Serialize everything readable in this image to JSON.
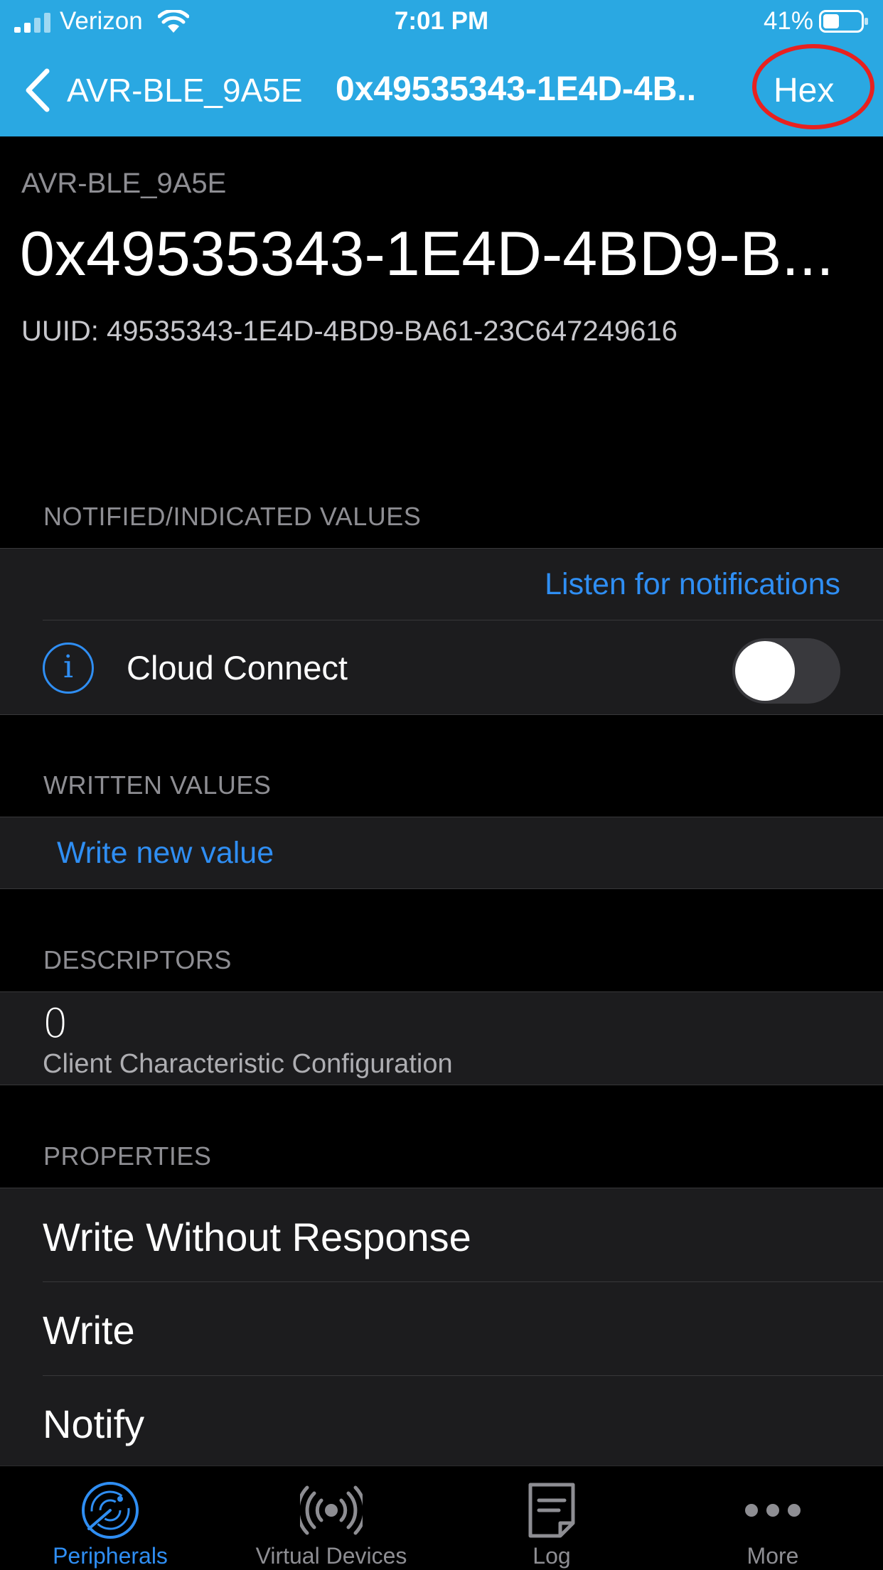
{
  "status_bar": {
    "carrier": "Verizon",
    "time": "7:01 PM",
    "battery": "41%"
  },
  "nav": {
    "back_label": "AVR-BLE_9A5E",
    "title": "0x49535343-1E4D-4B..",
    "format_button": "Hex"
  },
  "header": {
    "device_name": "AVR-BLE_9A5E",
    "characteristic": "0x49535343-1E4D-4BD9-B...",
    "uuid": "UUID: 49535343-1E4D-4BD9-BA61-23C647249616"
  },
  "notified": {
    "header": "NOTIFIED/INDICATED VALUES",
    "listen_label": "Listen for notifications",
    "cloud_connect_label": "Cloud Connect",
    "cloud_connect_on": false
  },
  "written": {
    "header": "WRITTEN VALUES",
    "write_label": "Write new value"
  },
  "descriptors": {
    "header": "DESCRIPTORS",
    "items": [
      {
        "value": "0",
        "name": "Client Characteristic Configuration"
      }
    ]
  },
  "properties": {
    "header": "PROPERTIES",
    "items": [
      "Write Without Response",
      "Write",
      "Notify"
    ]
  },
  "tabs": [
    {
      "label": "Peripherals",
      "icon": "radar-icon",
      "active": true
    },
    {
      "label": "Virtual Devices",
      "icon": "broadcast-icon",
      "active": false
    },
    {
      "label": "Log",
      "icon": "log-icon",
      "active": false
    },
    {
      "label": "More",
      "icon": "more-icon",
      "active": false
    }
  ],
  "colors": {
    "nav_background": "#2aa8e2",
    "accent_blue": "#2f8ef3",
    "highlight_circle": "#e8211f"
  }
}
